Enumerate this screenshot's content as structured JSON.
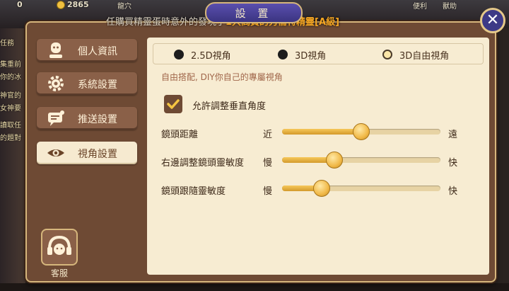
{
  "hud": {
    "counter_a": "0",
    "counter_b": "2865",
    "label_a": "龍穴",
    "label_b": "便利",
    "label_c": "獸助"
  },
  "side_tasks": [
    "任務",
    "集重前",
    "你的冰",
    "神官的",
    "女神要",
    "讀取任",
    "的題對"
  ],
  "marquee": {
    "prefix": "任購買精靈蛋時意外的發現了",
    "highlight": "1只高貴的秀倫特精靈[A級]"
  },
  "window": {
    "title": "設 置",
    "close_label": "✕"
  },
  "sidebar": {
    "items": [
      {
        "label": "個人資訊",
        "icon": "person-icon",
        "active": false
      },
      {
        "label": "系統設置",
        "icon": "gear-icon",
        "active": false
      },
      {
        "label": "推送設置",
        "icon": "message-icon",
        "active": false
      },
      {
        "label": "視角設置",
        "icon": "eye-icon",
        "active": true
      }
    ],
    "customer_service": {
      "label": "客服",
      "icon": "headset-icon"
    }
  },
  "camera": {
    "options": [
      {
        "label": "2.5D視角",
        "selected": false
      },
      {
        "label": "3D視角",
        "selected": false
      },
      {
        "label": "3D自由視角",
        "selected": true
      }
    ],
    "description": "自由搭配, DIY你自己的專屬視角",
    "vertical_adjust": {
      "label": "允許調整垂直角度",
      "checked": true
    }
  },
  "sliders": [
    {
      "label": "鏡頭距離",
      "min_label": "近",
      "max_label": "遠",
      "value": 0.5
    },
    {
      "label": "右邊調整鏡頭靈敏度",
      "min_label": "慢",
      "max_label": "快",
      "value": 0.33
    },
    {
      "label": "鏡頭跟隨靈敏度",
      "min_label": "慢",
      "max_label": "快",
      "value": 0.25
    }
  ],
  "colors": {
    "accent": "#f1b948",
    "panel": "#6e4a34",
    "content_bg": "#f7ecd2",
    "title_tab": "#3b3481"
  }
}
